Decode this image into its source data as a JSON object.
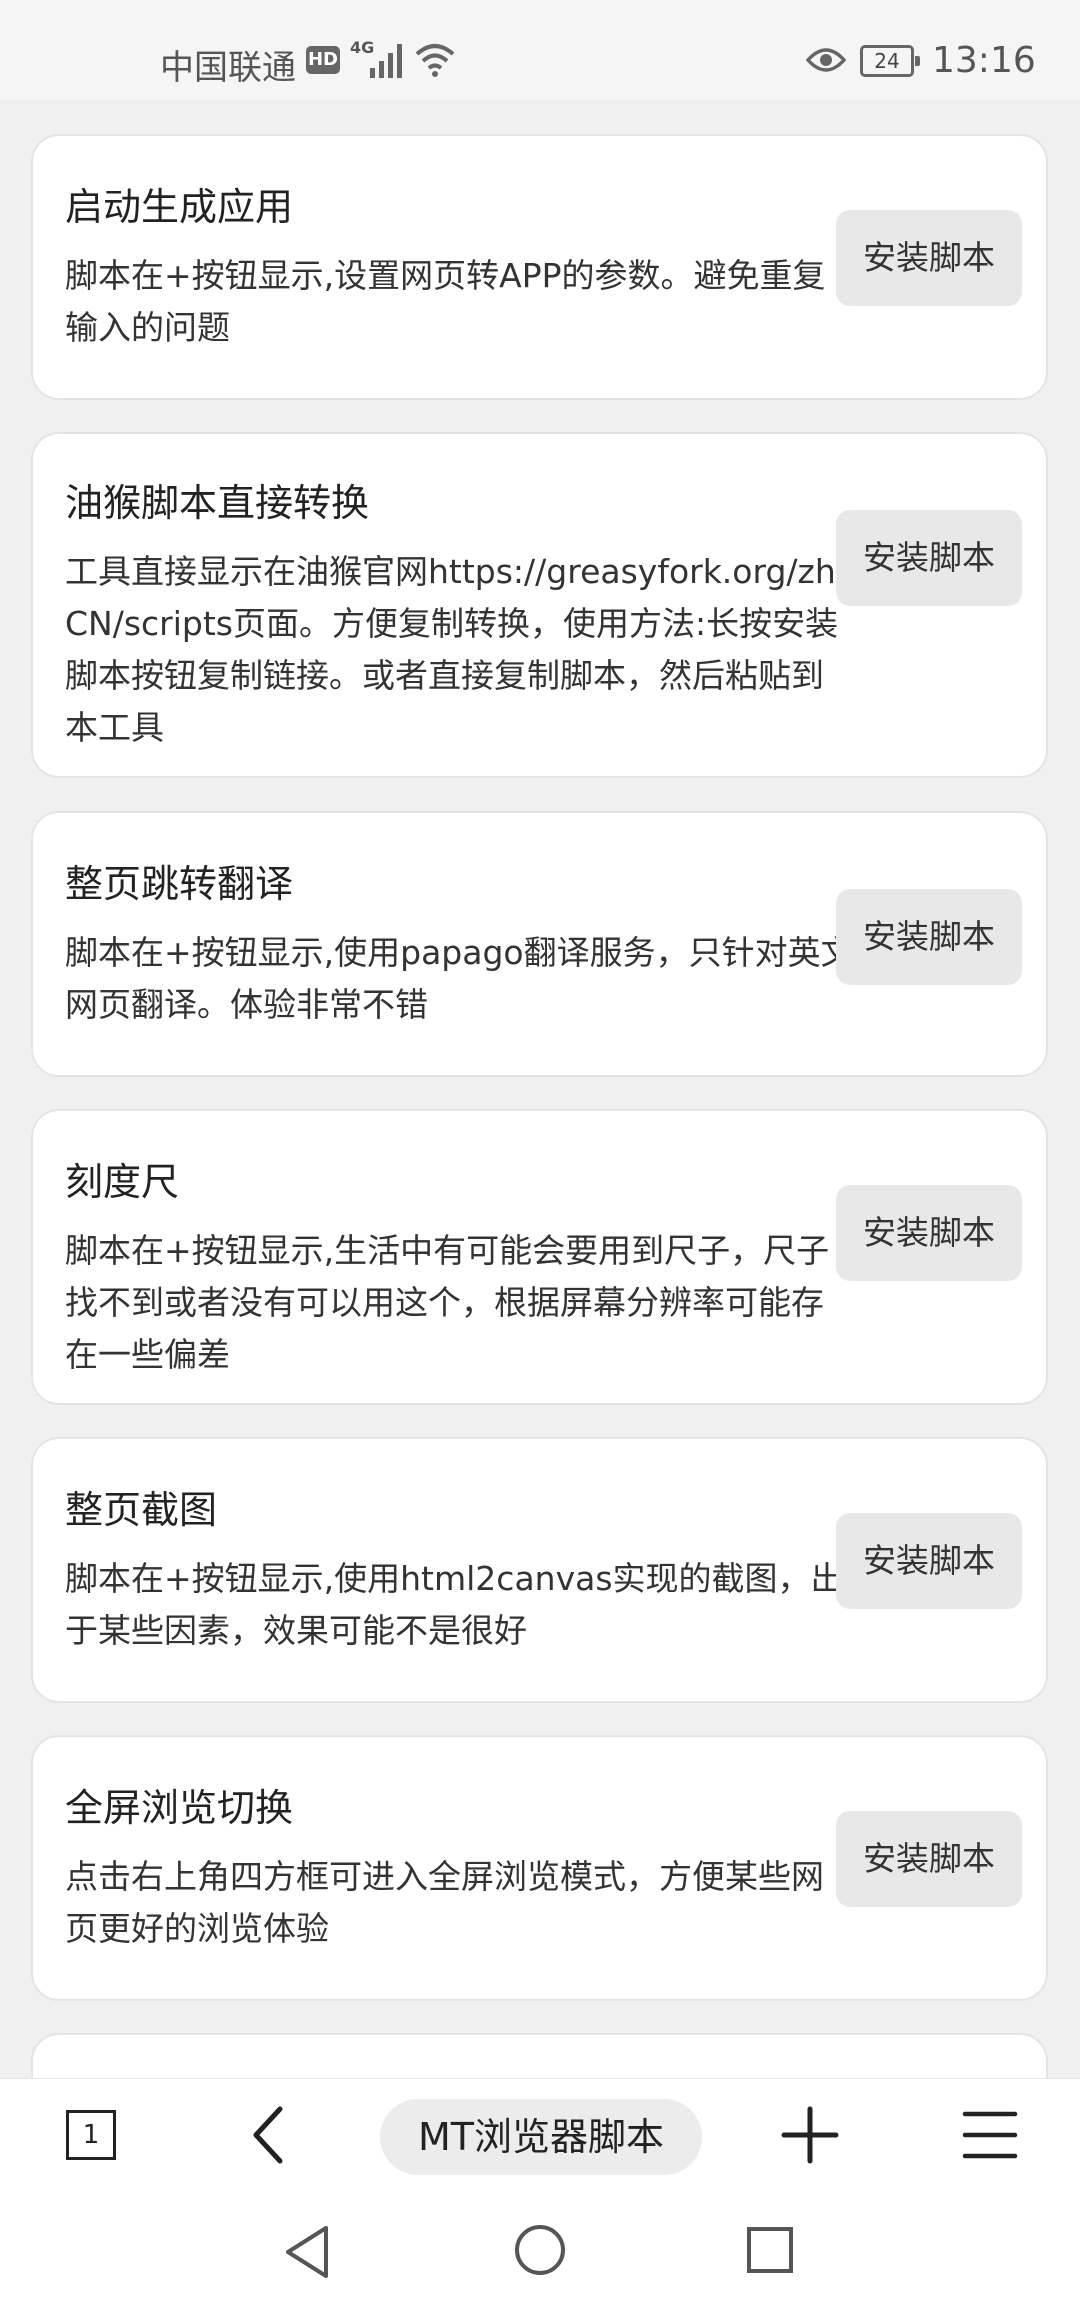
{
  "status_bar": {
    "carrier": "中国联通",
    "hd": "HD",
    "network": "4G",
    "battery": "24",
    "time": "13:16"
  },
  "scripts": [
    {
      "title": "启动生成应用",
      "description": "脚本在+按钮显示,设置网页转APP的参数。避免重复输入的问题",
      "button": "安装脚本"
    },
    {
      "title": "油猴脚本直接转换",
      "description": "工具直接显示在油猴官网https://greasyfork.org/zh-CN/scripts页面。方便复制转换，使用方法:长按安装脚本按钮复制链接。或者直接复制脚本，然后粘贴到本工具",
      "button": "安装脚本"
    },
    {
      "title": "整页跳转翻译",
      "description": "脚本在+按钮显示,使用papago翻译服务，只针对英文网页翻译。体验非常不错",
      "button": "安装脚本"
    },
    {
      "title": "刻度尺",
      "description": "脚本在+按钮显示,生活中有可能会要用到尺子，尺子找不到或者没有可以用这个，根据屏幕分辨率可能存在一些偏差",
      "button": "安装脚本"
    },
    {
      "title": "整页截图",
      "description": "脚本在+按钮显示,使用html2canvas实现的截图，出于某些因素，效果可能不是很好",
      "button": "安装脚本"
    },
    {
      "title": "全屏浏览切换",
      "description": "点击右上角四方框可进入全屏浏览模式，方便某些网页更好的浏览体验",
      "button": "安装脚本"
    }
  ],
  "bottom_bar": {
    "tab_count": "1",
    "page_title": "MT浏览器脚本"
  }
}
